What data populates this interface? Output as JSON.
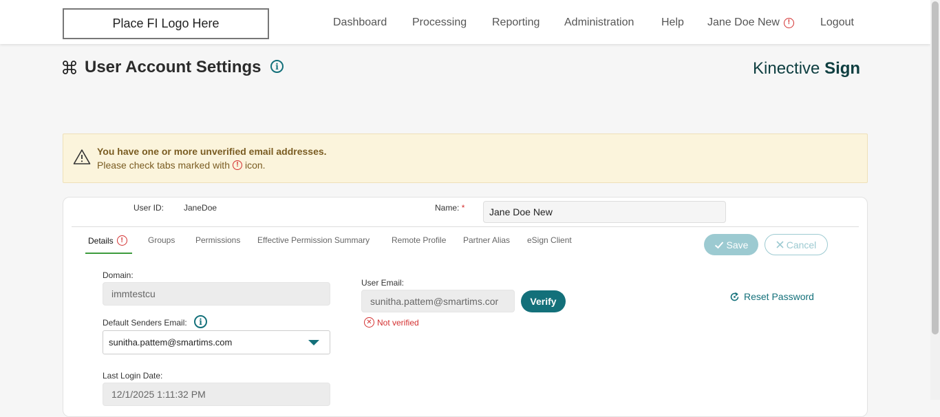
{
  "header": {
    "logo_text": "Place FI Logo Here",
    "nav": {
      "dashboard": "Dashboard",
      "processing": "Processing",
      "reporting": "Reporting",
      "administration": "Administration",
      "help": "Help",
      "user": "Jane Doe New",
      "logout": "Logout"
    }
  },
  "page": {
    "title": "User Account Settings",
    "brand_light": "Kinective ",
    "brand_bold": "Sign"
  },
  "banner": {
    "title": "You have one or more unverified email addresses.",
    "line_before": "Please check tabs marked with",
    "line_after": "icon."
  },
  "form": {
    "user_id_label": "User ID:",
    "user_id_value": "JaneDoe",
    "name_label": "Name:",
    "required_mark": "*",
    "name_value": "Jane Doe New"
  },
  "tabs": [
    "Details",
    "Groups",
    "Permissions",
    "Effective Permission Summary",
    "Remote Profile",
    "Partner Alias",
    "eSign Client"
  ],
  "actions": {
    "save": "Save",
    "cancel": "Cancel"
  },
  "details": {
    "domain_label": "Domain:",
    "domain_value": "immtestcu",
    "default_sender_label": "Default Senders Email:",
    "default_sender_value": "sunitha.pattem@smartims.com",
    "last_login_label": "Last Login Date:",
    "last_login_value": "12/1/2025 1:11:32 PM",
    "user_email_label": "User Email:",
    "user_email_value": "sunitha.pattem@smartims.cor",
    "verify_label": "Verify",
    "not_verified_label": "Not verified",
    "reset_password_label": "Reset Password"
  },
  "colors": {
    "accent": "#13707a",
    "error": "#d32f2f",
    "banner_bg": "#fbf4dc",
    "tab_underline": "#3c9b3c"
  }
}
